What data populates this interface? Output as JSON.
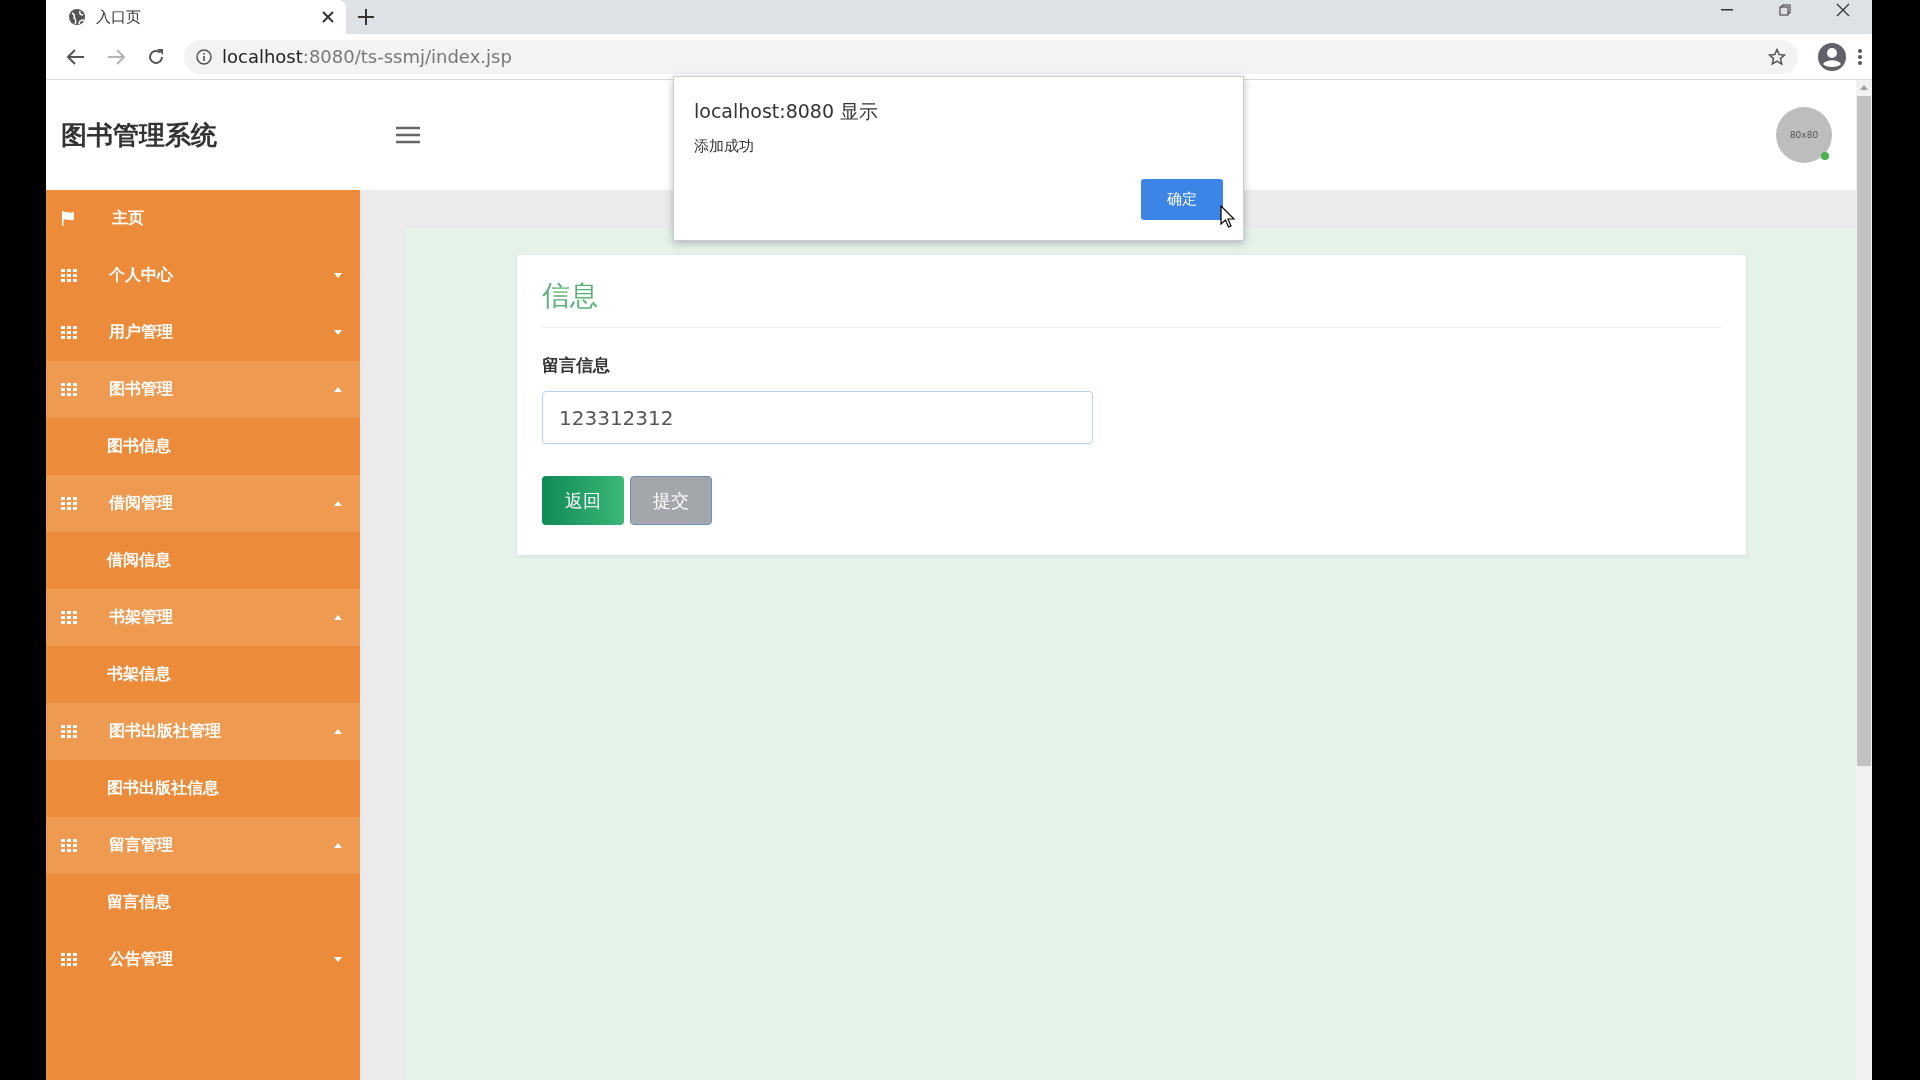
{
  "browser": {
    "tab_title": "入口页",
    "url_host": "localhost",
    "url_path": ":8080/ts-ssmj/index.jsp",
    "forward_disabled": true
  },
  "header": {
    "title": "图书管理系统",
    "avatar_text": "80x80",
    "online": true
  },
  "sidebar": {
    "items": [
      {
        "label": "主页",
        "kind": "home"
      },
      {
        "label": "个人中心",
        "kind": "group",
        "expanded": false
      },
      {
        "label": "用户管理",
        "kind": "group",
        "expanded": false
      },
      {
        "label": "图书管理",
        "kind": "group",
        "expanded": true,
        "children": [
          {
            "label": "图书信息"
          }
        ]
      },
      {
        "label": "借阅管理",
        "kind": "group",
        "expanded": true,
        "children": [
          {
            "label": "借阅信息"
          }
        ]
      },
      {
        "label": "书架管理",
        "kind": "group",
        "expanded": true,
        "children": [
          {
            "label": "书架信息"
          }
        ]
      },
      {
        "label": "图书出版社管理",
        "kind": "group",
        "expanded": true,
        "children": [
          {
            "label": "图书出版社信息"
          }
        ]
      },
      {
        "label": "留言管理",
        "kind": "group",
        "expanded": true,
        "children": [
          {
            "label": "留言信息"
          }
        ]
      },
      {
        "label": "公告管理",
        "kind": "group",
        "expanded": false
      }
    ]
  },
  "card": {
    "title": "信息",
    "field": {
      "label": "留言信息",
      "value": "123312312"
    },
    "buttons": [
      {
        "label": "返回",
        "kind": "primary"
      },
      {
        "label": "提交",
        "kind": "secondary"
      }
    ]
  },
  "dialog": {
    "title": "localhost:8080 显示",
    "message": "添加成功",
    "button": "确定"
  }
}
